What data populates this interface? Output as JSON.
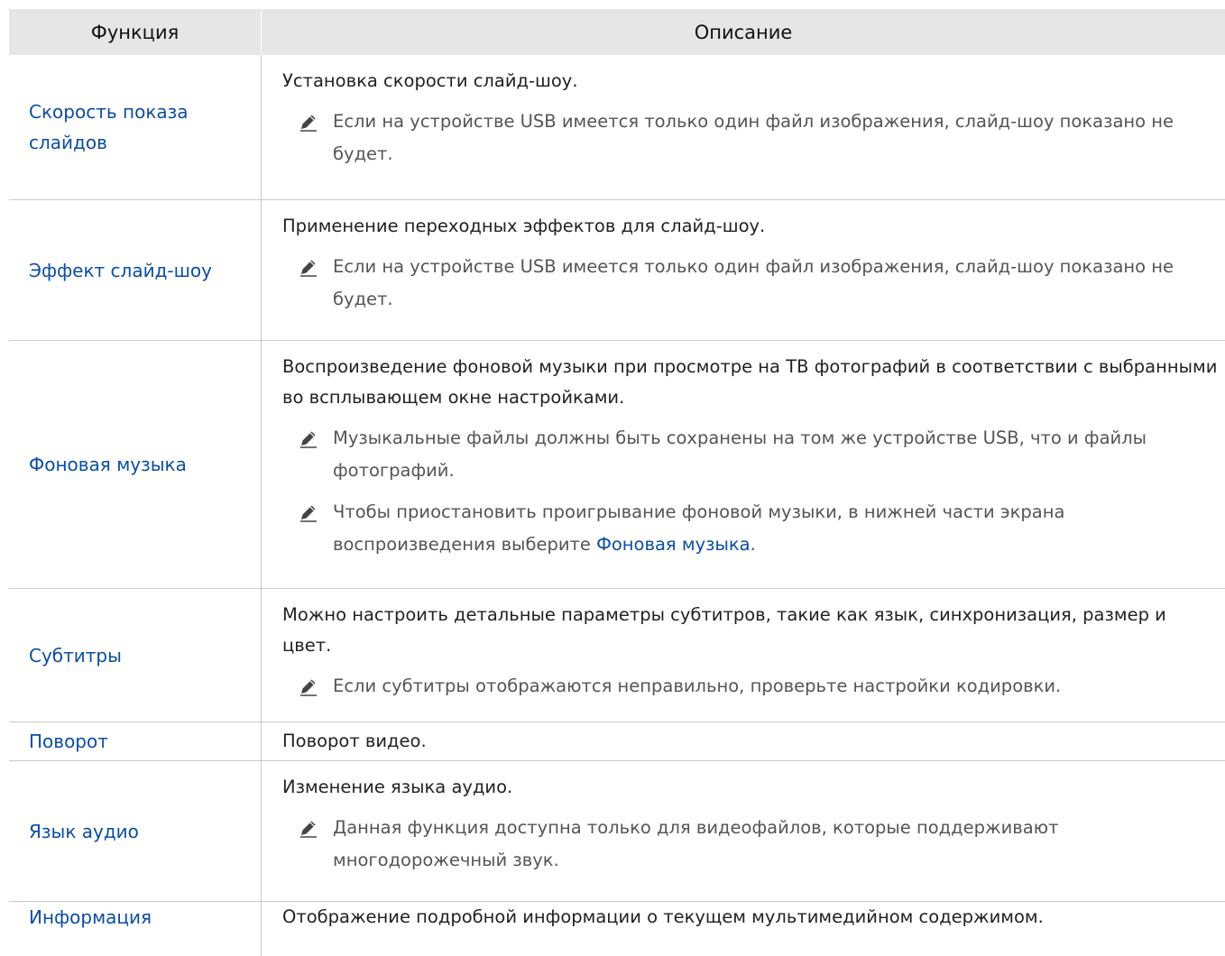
{
  "table": {
    "headers": {
      "function": "Функция",
      "description": "Описание"
    },
    "rows": [
      {
        "name": "Скорость показа слайдов",
        "desc": "Установка скорости слайд-шоу.",
        "notes": [
          "Если на устройстве USB имеется только один файл изображения, слайд-шоу показано не будет."
        ]
      },
      {
        "name": "Эффект слайд-шоу",
        "desc": "Применение переходных эффектов для слайд-шоу.",
        "notes": [
          "Если на устройстве USB имеется только один файл изображения, слайд-шоу показано не будет."
        ]
      },
      {
        "name": "Фоновая музыка",
        "desc": "Воспроизведение фоновой музыки при просмотре на ТВ фотографий в соответствии с выбранными во всплывающем окне настройками.",
        "notes": [
          "Музыкальные файлы должны быть сохранены на том же устройстве USB, что и файлы фотографий.",
          "Чтобы приостановить проигрывание фоновой музыки, в нижней части экрана воспроизведения выберите"
        ],
        "note_link": "Фоновая музыка",
        "note_end": "."
      },
      {
        "name": "Субтитры",
        "desc": "Можно настроить детальные параметры субтитров, такие как язык, синхронизация, размер и цвет.",
        "notes": [
          "Если субтитры отображаются неправильно, проверьте настройки кодировки."
        ]
      },
      {
        "name": "Поворот",
        "desc": "Поворот видео.",
        "notes": []
      },
      {
        "name": "Язык аудио",
        "desc": "Изменение языка аудио.",
        "notes": [
          "Данная функция доступна только для видеофайлов, которые поддерживают многодорожечный звук."
        ]
      },
      {
        "name": "Информация",
        "desc": "Отображение подробной информации о текущем мультимедийном содержимом.",
        "notes": []
      }
    ]
  },
  "icons": {
    "note": "pencil-icon"
  },
  "colors": {
    "link": "#0b4ea2",
    "header_bg": "#e6e6e6",
    "note_text": "#555555"
  }
}
